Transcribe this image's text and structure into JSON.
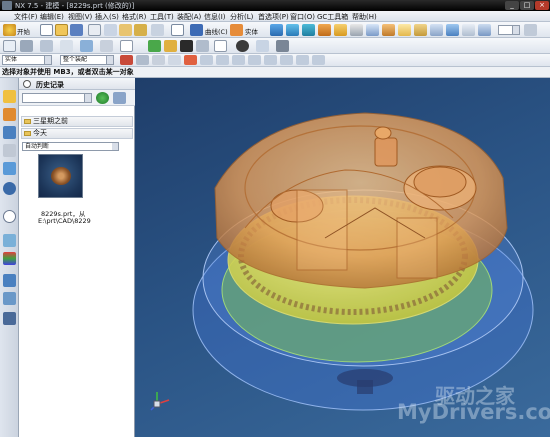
{
  "window": {
    "title": "NX 7.5 - 建模 - [8229s.prt (修改的)]"
  },
  "menus": [
    "文件(F)",
    "编辑(E)",
    "视图(V)",
    "插入(S)",
    "格式(R)",
    "工具(T)",
    "装配(A)",
    "信息(I)",
    "分析(L)",
    "首选项(P)",
    "窗口(O)",
    "GC工具箱",
    "帮助(H)"
  ],
  "toolbar": {
    "start_label": "开始",
    "curve_label": "曲线(C)",
    "solid_label": "实体",
    "filter_value": "实体",
    "scope_value": "整个装配"
  },
  "prompt": "选择对象并使用 MB3，或者双击某一对象",
  "history": {
    "title": "历史记录",
    "group1": "三星期之前",
    "group2": "今天",
    "sort_value": "自动判断",
    "item_name": "8229s.prt，从",
    "item_path": "E:\\prt\\CAD\\8229"
  },
  "watermark": {
    "cn": "驱动之家",
    "en": "MyDrivers.com"
  },
  "icons": {
    "app": "nx-logo-icon",
    "res_bar": [
      "assembly-navigator-icon",
      "constraint-navigator-icon",
      "part-navigator-icon",
      "reuse-library-icon",
      "hd3d-tools-icon",
      "web-browser-icon",
      "history-icon",
      "system-materials-icon",
      "process-studio-icon",
      "roles-icon",
      "system-scenes-icon"
    ]
  }
}
